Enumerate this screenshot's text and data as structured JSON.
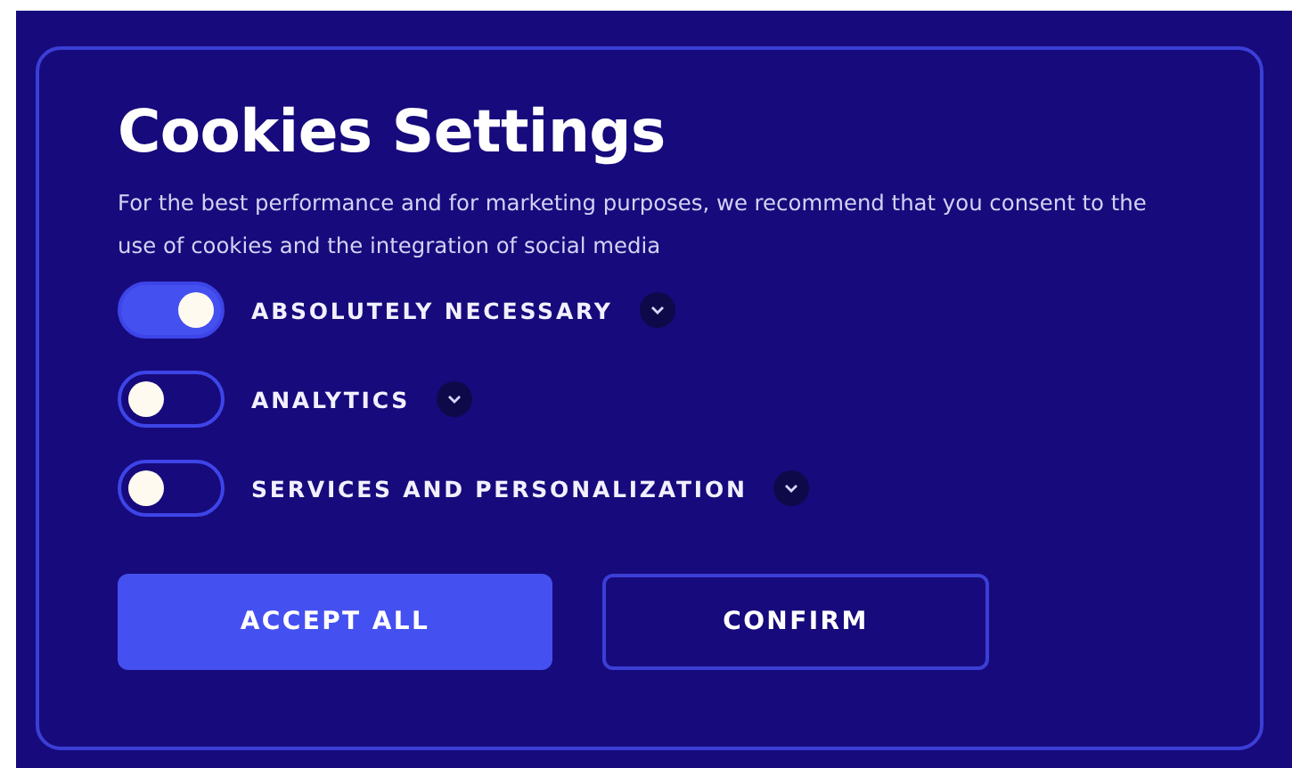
{
  "title": "Cookies Settings",
  "description": "For the best performance and for marketing purposes, we recommend that you consent to the use of cookies and the integration of social media",
  "options": [
    {
      "label": "ABSOLUTELY NECESSARY",
      "on": true
    },
    {
      "label": "ANALYTICS",
      "on": false
    },
    {
      "label": "SERVICES AND PERSONALIZATION",
      "on": false
    }
  ],
  "buttons": [
    {
      "label": "ACCEPT ALL",
      "kind": "primary"
    },
    {
      "label": "CONFIRM",
      "kind": "outline"
    }
  ]
}
